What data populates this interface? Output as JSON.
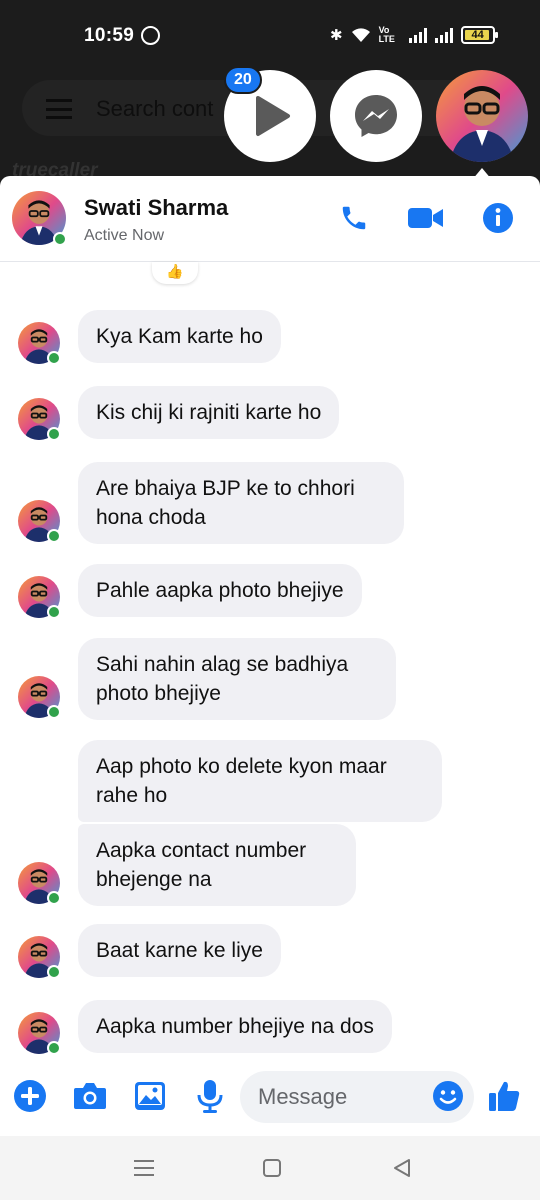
{
  "statusbar": {
    "time": "10:59",
    "battery": "44",
    "network": "Vo LTE"
  },
  "background_app": {
    "search_placeholder": "Search cont",
    "brand": "truecaller"
  },
  "chat_heads": {
    "badge_count": "20"
  },
  "contact": {
    "name": "Swati Sharma",
    "status": "Active Now"
  },
  "reaction": "👍",
  "messages": [
    {
      "text": "Kya Kam karte ho"
    },
    {
      "text": "Kis chij ki rajniti karte ho"
    },
    {
      "text": "Are bhaiya BJP ke to chhori hona choda"
    },
    {
      "text": "Pahle aapka photo bhejiye"
    },
    {
      "text": "Sahi nahin alag se badhiya photo bhejiye"
    },
    {
      "text": "Aap photo ko delete kyon maar rahe ho"
    },
    {
      "text": "Aapka contact number bhejenge na"
    },
    {
      "text": "Baat karne ke liye"
    },
    {
      "text": "Aapka number bhejiye na dos"
    }
  ],
  "composer": {
    "placeholder": "Message"
  },
  "colors": {
    "accent": "#1877f2",
    "bubble": "#f0f0f4",
    "online": "#31a24c"
  }
}
